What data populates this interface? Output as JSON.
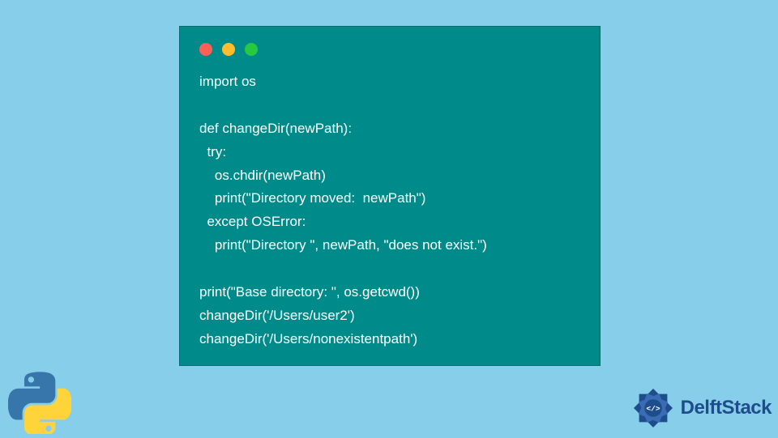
{
  "code": {
    "lines": [
      "import os",
      "",
      "def changeDir(newPath):",
      "  try:",
      "    os.chdir(newPath)",
      "    print(\"Directory moved:  newPath\")",
      "  except OSError:",
      "    print(\"Directory \", newPath, \"does not exist.\")",
      "",
      "print(\"Base directory: \", os.getcwd())",
      "changeDir('/Users/user2')",
      "changeDir('/Users/nonexistentpath')"
    ]
  },
  "branding": {
    "site_name": "DelftStack"
  },
  "colors": {
    "background": "#87ceeb",
    "window": "#008b8b",
    "dot_red": "#ff5f56",
    "dot_yellow": "#ffbd2e",
    "dot_green": "#27c93f",
    "brand_text": "#1e4d8c"
  }
}
